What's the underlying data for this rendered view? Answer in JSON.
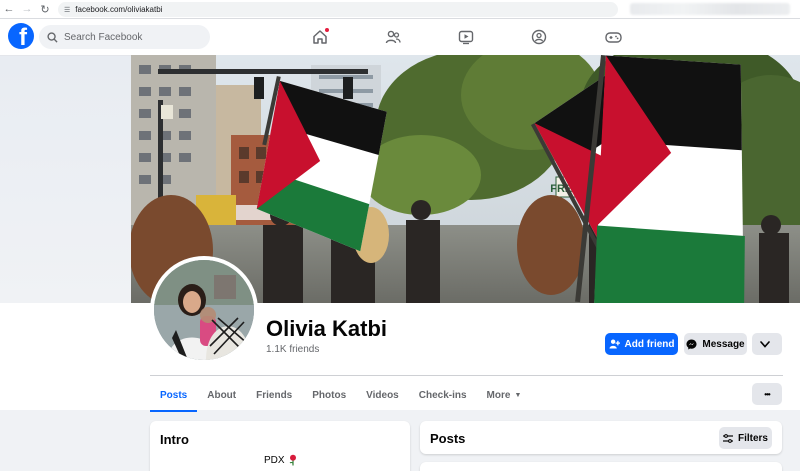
{
  "browser": {
    "url": "facebook.com/oliviakatbi"
  },
  "header": {
    "logo_letter": "f",
    "search_placeholder": "Search Facebook"
  },
  "profile": {
    "name": "Olivia Katbi",
    "friends": "1.1K friends",
    "actions": {
      "add_friend": "Add friend",
      "message": "Message"
    }
  },
  "cover_scene": {
    "sign_text": "FREE GAZA"
  },
  "tabs": [
    {
      "label": "Posts",
      "active": true
    },
    {
      "label": "About"
    },
    {
      "label": "Friends"
    },
    {
      "label": "Photos"
    },
    {
      "label": "Videos"
    },
    {
      "label": "Check-ins"
    },
    {
      "label": "More"
    }
  ],
  "more_menu_label": "•••",
  "intro": {
    "title": "Intro",
    "location_text": "PDX"
  },
  "posts": {
    "title": "Posts",
    "filters_label": "Filters"
  },
  "colors": {
    "brand_blue": "#0866ff",
    "page_bg": "#f0f2f5",
    "flag_red": "#c8102e",
    "flag_green": "#1b7a3a"
  }
}
